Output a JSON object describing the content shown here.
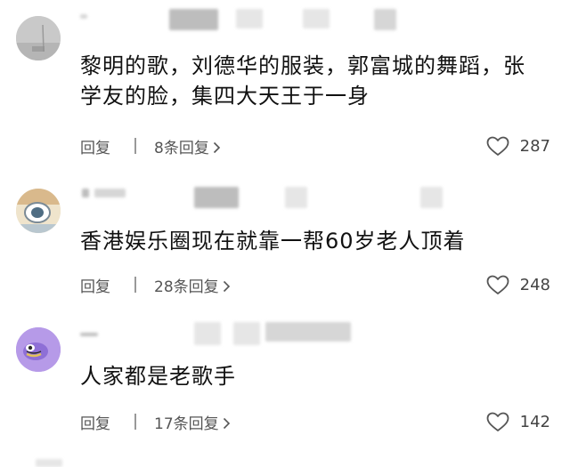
{
  "comments": [
    {
      "text": "黎明的歌，刘德华的服装，郭富城的舞蹈，张学友的脸，集四大天王于一身",
      "reply_label": "回复",
      "replies_label": "8条回复",
      "likes": "287"
    },
    {
      "text": "香港娱乐圈现在就靠一帮60岁老人顶着",
      "reply_label": "回复",
      "replies_label": "28条回复",
      "likes": "248"
    },
    {
      "text": "人家都是老歌手",
      "reply_label": "回复",
      "replies_label": "17条回复",
      "likes": "142"
    }
  ],
  "icons": {
    "like": "heart-outline-icon",
    "chevron": "chevron-right-icon"
  },
  "colors": {
    "text": "#111111",
    "meta": "#555555",
    "separator": "#999999",
    "avatar_purple": "#a78be0"
  }
}
